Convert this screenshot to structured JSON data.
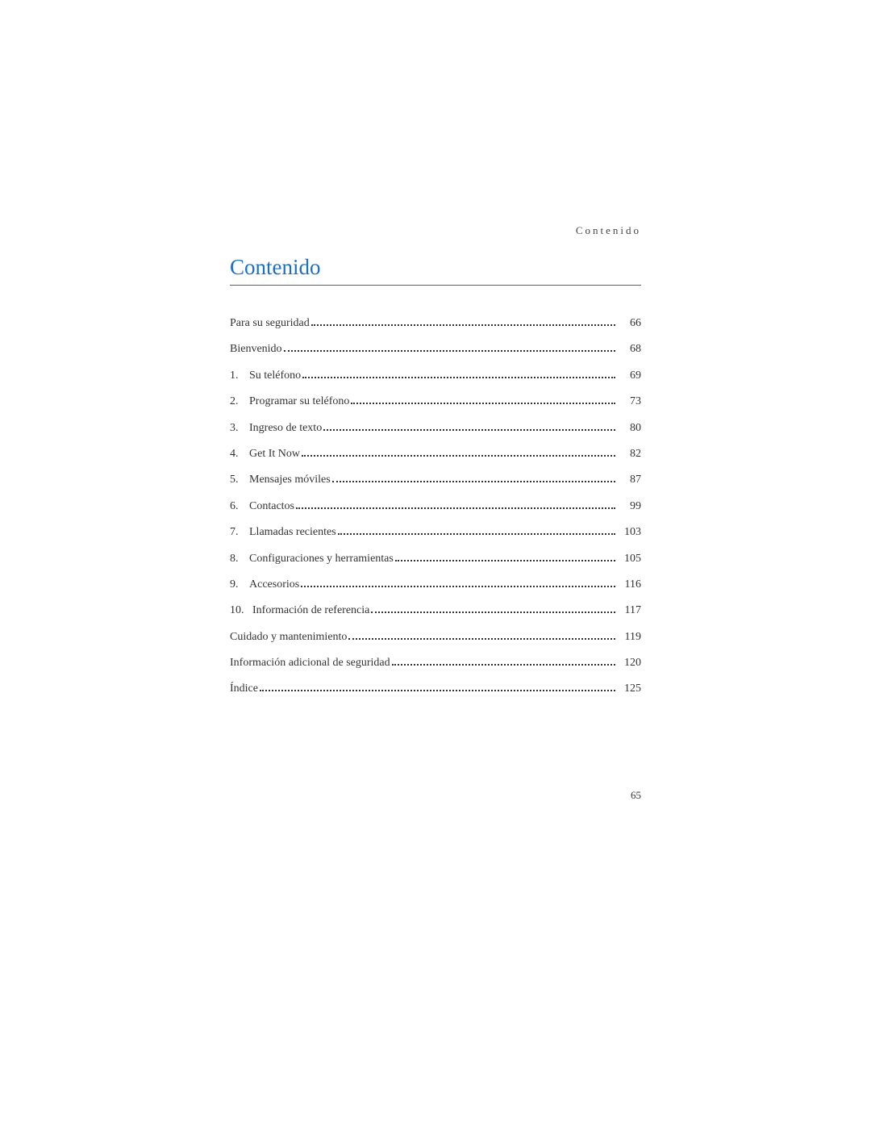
{
  "header_label": "Contenido",
  "title": "Contenido",
  "page_number": "65",
  "entries": [
    {
      "num": "",
      "label": "Para su seguridad",
      "page": "66"
    },
    {
      "num": "",
      "label": "Bienvenido",
      "page": "68"
    },
    {
      "num": "1.",
      "label": "Su teléfono",
      "page": "69"
    },
    {
      "num": "2.",
      "label": "Programar su teléfono",
      "page": "73"
    },
    {
      "num": "3.",
      "label": "Ingreso de texto",
      "page": "80"
    },
    {
      "num": "4.",
      "label": "Get It Now",
      "page": "82"
    },
    {
      "num": "5.",
      "label": "Mensajes móviles",
      "page": "87"
    },
    {
      "num": "6.",
      "label": "Contactos",
      "page": "99"
    },
    {
      "num": "7.",
      "label": "Llamadas recientes",
      "page": "103"
    },
    {
      "num": "8.",
      "label": "Configuraciones y herramientas",
      "page": "105"
    },
    {
      "num": "9.",
      "label": "Accesorios",
      "page": "116"
    },
    {
      "num": "10.",
      "label": "Información de referencia",
      "page": "117"
    },
    {
      "num": "",
      "label": "Cuidado y mantenimiento",
      "page": "119"
    },
    {
      "num": "",
      "label": "Información adicional de seguridad",
      "page": "120"
    },
    {
      "num": "",
      "label": "Índice",
      "page": "125"
    }
  ]
}
